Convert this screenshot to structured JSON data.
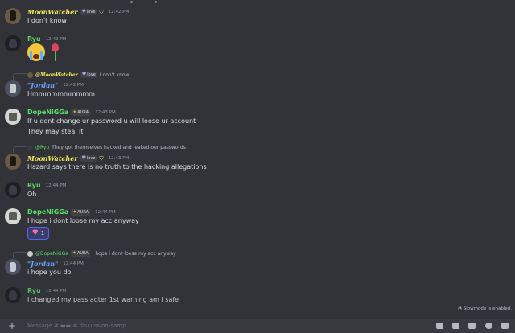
{
  "messages": [
    {
      "author": "MoonWatcher",
      "badge": "love",
      "time": "12:42 PM",
      "text": "I don't know"
    },
    {
      "author": "Ryu",
      "time": "12:42 PM"
    },
    {
      "reply_author": "@MoonWatcher",
      "reply_badge": "love",
      "reply_text": "I don't know",
      "author": "\"Jordan\"",
      "time": "12:42 PM",
      "text": "Hmmmmmmmmmm"
    },
    {
      "author": "DopeNiGGa",
      "badge": "AURA",
      "time": "12:43 PM",
      "text": "If u dont change ur password u will loose ur account",
      "text2": "They may steal it"
    },
    {
      "reply_author": "@Ryu",
      "reply_text": "They got themselves hacked and leaked our passwords",
      "author": "MoonWatcher",
      "badge": "love",
      "time": "12:43 PM",
      "text": "Hazard says there is no truth to the hacking allegations"
    },
    {
      "author": "Ryu",
      "time": "12:44 PM",
      "text": "Oh"
    },
    {
      "author": "DopeNiGGa",
      "badge": "AURA",
      "time": "12:44 PM",
      "text": "I hope i dont loose my acc anyway",
      "reaction_count": "1"
    },
    {
      "reply_author": "@DopeNiGGa",
      "reply_badge": "AURA",
      "reply_text": "I hope i dont loose my acc anyway",
      "author": "\"Jordan\"",
      "time": "12:44 PM",
      "text": "i hope you do"
    },
    {
      "author": "Ryu",
      "time": "12:44 PM",
      "text": "I changed my pass adter 1st warning am i safe"
    }
  ],
  "slowmode": "Slowmode is enabled.",
  "composer": {
    "placeholder": "Message # ▬▬ # discussion-samp"
  },
  "icons": {
    "add": "plus-icon",
    "gift": "gift-icon",
    "gif": "gif-icon",
    "sticker": "sticker-icon",
    "emoji": "emoji-icon",
    "apps": "apps-icon"
  }
}
